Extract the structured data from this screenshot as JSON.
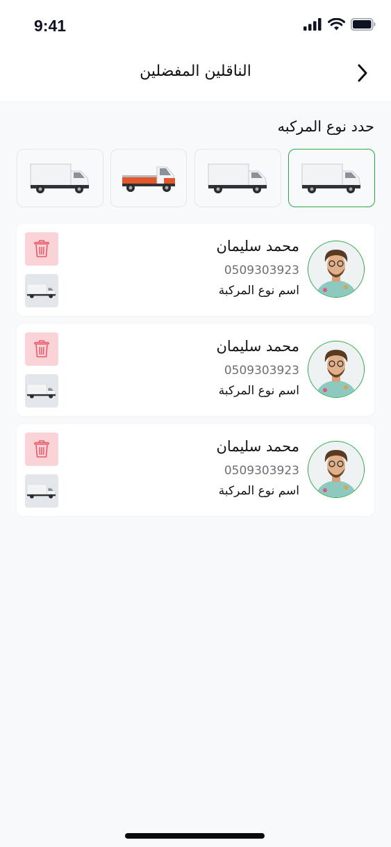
{
  "status_bar": {
    "time": "9:41"
  },
  "header": {
    "title": "الناقلين المفضلين",
    "back_icon": "chevron-right-icon"
  },
  "vehicle_section": {
    "title": "حدد نوع المركبه",
    "options": [
      {
        "icon": "box-truck-icon",
        "selected": true
      },
      {
        "icon": "box-truck-icon",
        "selected": false
      },
      {
        "icon": "flatbed-truck-icon",
        "selected": false
      },
      {
        "icon": "box-truck-icon",
        "selected": false
      }
    ]
  },
  "carriers": [
    {
      "name": "محمد سليمان",
      "phone": "0509303923",
      "vehicle_type": "اسم نوع المركبة"
    },
    {
      "name": "محمد سليمان",
      "phone": "0509303923",
      "vehicle_type": "اسم نوع المركبة"
    },
    {
      "name": "محمد سليمان",
      "phone": "0509303923",
      "vehicle_type": "اسم نوع المركبة"
    }
  ],
  "colors": {
    "accent_green": "#2aa84a",
    "delete_bg": "#f9d3d6",
    "delete_icon": "#e8586a"
  }
}
